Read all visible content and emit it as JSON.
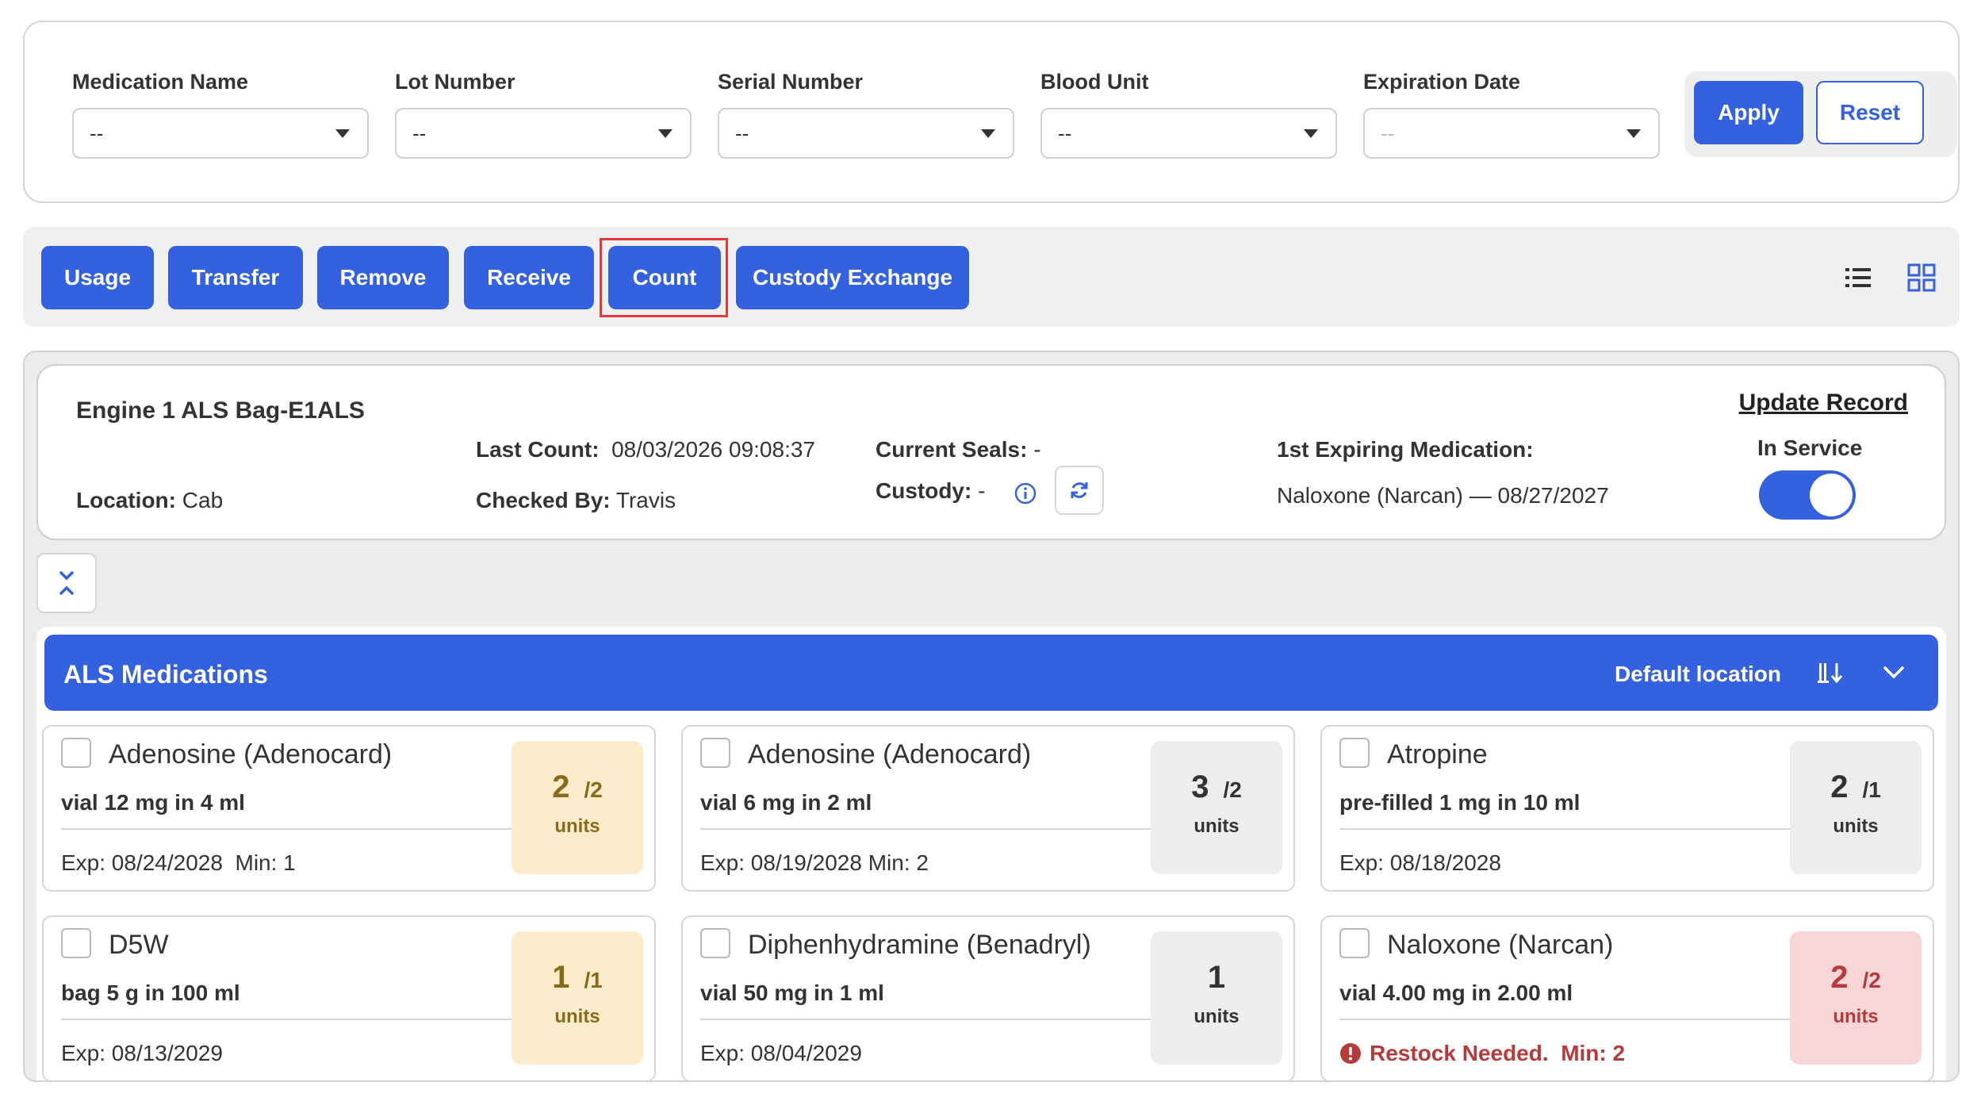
{
  "filters": [
    {
      "label": "Medication Name",
      "value": "--",
      "disabled": false
    },
    {
      "label": "Lot Number",
      "value": "--",
      "disabled": false
    },
    {
      "label": "Serial Number",
      "value": "--",
      "disabled": false
    },
    {
      "label": "Blood Unit",
      "value": "--",
      "disabled": false
    },
    {
      "label": "Expiration Date",
      "value": "--",
      "disabled": true
    }
  ],
  "filter_actions": {
    "apply": "Apply",
    "reset": "Reset"
  },
  "actions": [
    "Usage",
    "Transfer",
    "Remove",
    "Receive",
    "Count",
    "Custody Exchange"
  ],
  "bag": {
    "title": "Engine 1 ALS Bag-E1ALS",
    "location_label": "Location:",
    "location": "Cab",
    "last_count_label": "Last Count:",
    "last_count": "08/03/2026 09:08:37",
    "checked_by_label": "Checked By:",
    "checked_by": "Travis",
    "seals_label": "Current Seals:",
    "seals": "-",
    "custody_label": "Custody:",
    "custody": "-",
    "expiring_label": "1st Expiring Medication:",
    "expiring": "Naloxone (Narcan) — 08/27/2027",
    "update_record": "Update Record",
    "in_service_label": "In Service",
    "in_service": true
  },
  "section": {
    "title": "ALS Medications",
    "default_location": "Default location"
  },
  "medications": [
    {
      "name": "Adenosine (Adenocard)",
      "desc": "vial 12 mg in 4 ml",
      "exp": "Exp: 08/24/2028  Min: 1",
      "count": "2",
      "max": "/2",
      "units": "units",
      "status": "yellow"
    },
    {
      "name": "Adenosine (Adenocard)",
      "desc": "vial 6 mg in 2 ml",
      "exp": "Exp: 08/19/2028 Min: 2",
      "count": "3",
      "max": "/2",
      "units": "units",
      "status": "gray"
    },
    {
      "name": "Atropine",
      "desc": "pre-filled 1 mg in 10 ml",
      "exp": "Exp: 08/18/2028",
      "count": "2",
      "max": "/1",
      "units": "units",
      "status": "gray"
    },
    {
      "name": "D5W",
      "desc": "bag 5 g in 100 ml",
      "exp": "Exp: 08/13/2029",
      "count": "1",
      "max": "/1",
      "units": "units",
      "status": "yellow"
    },
    {
      "name": "Diphenhydramine (Benadryl)",
      "desc": "vial 50 mg in 1 ml",
      "exp": "Exp: 08/04/2029",
      "count": "1",
      "max": "",
      "units": "units",
      "status": "gray"
    },
    {
      "name": "Naloxone (Narcan)",
      "desc": "vial 4.00 mg in 2.00 ml",
      "restock": "Restock Needed.  Min: 2",
      "count": "2",
      "max": "/2",
      "units": "units",
      "status": "red"
    }
  ],
  "colors": {
    "primary": "#3361e0",
    "highlight": "#e13a3a",
    "warning_bg": "#fbedcb",
    "danger_bg": "#f8d6d8",
    "danger_text": "#b73a3a"
  }
}
